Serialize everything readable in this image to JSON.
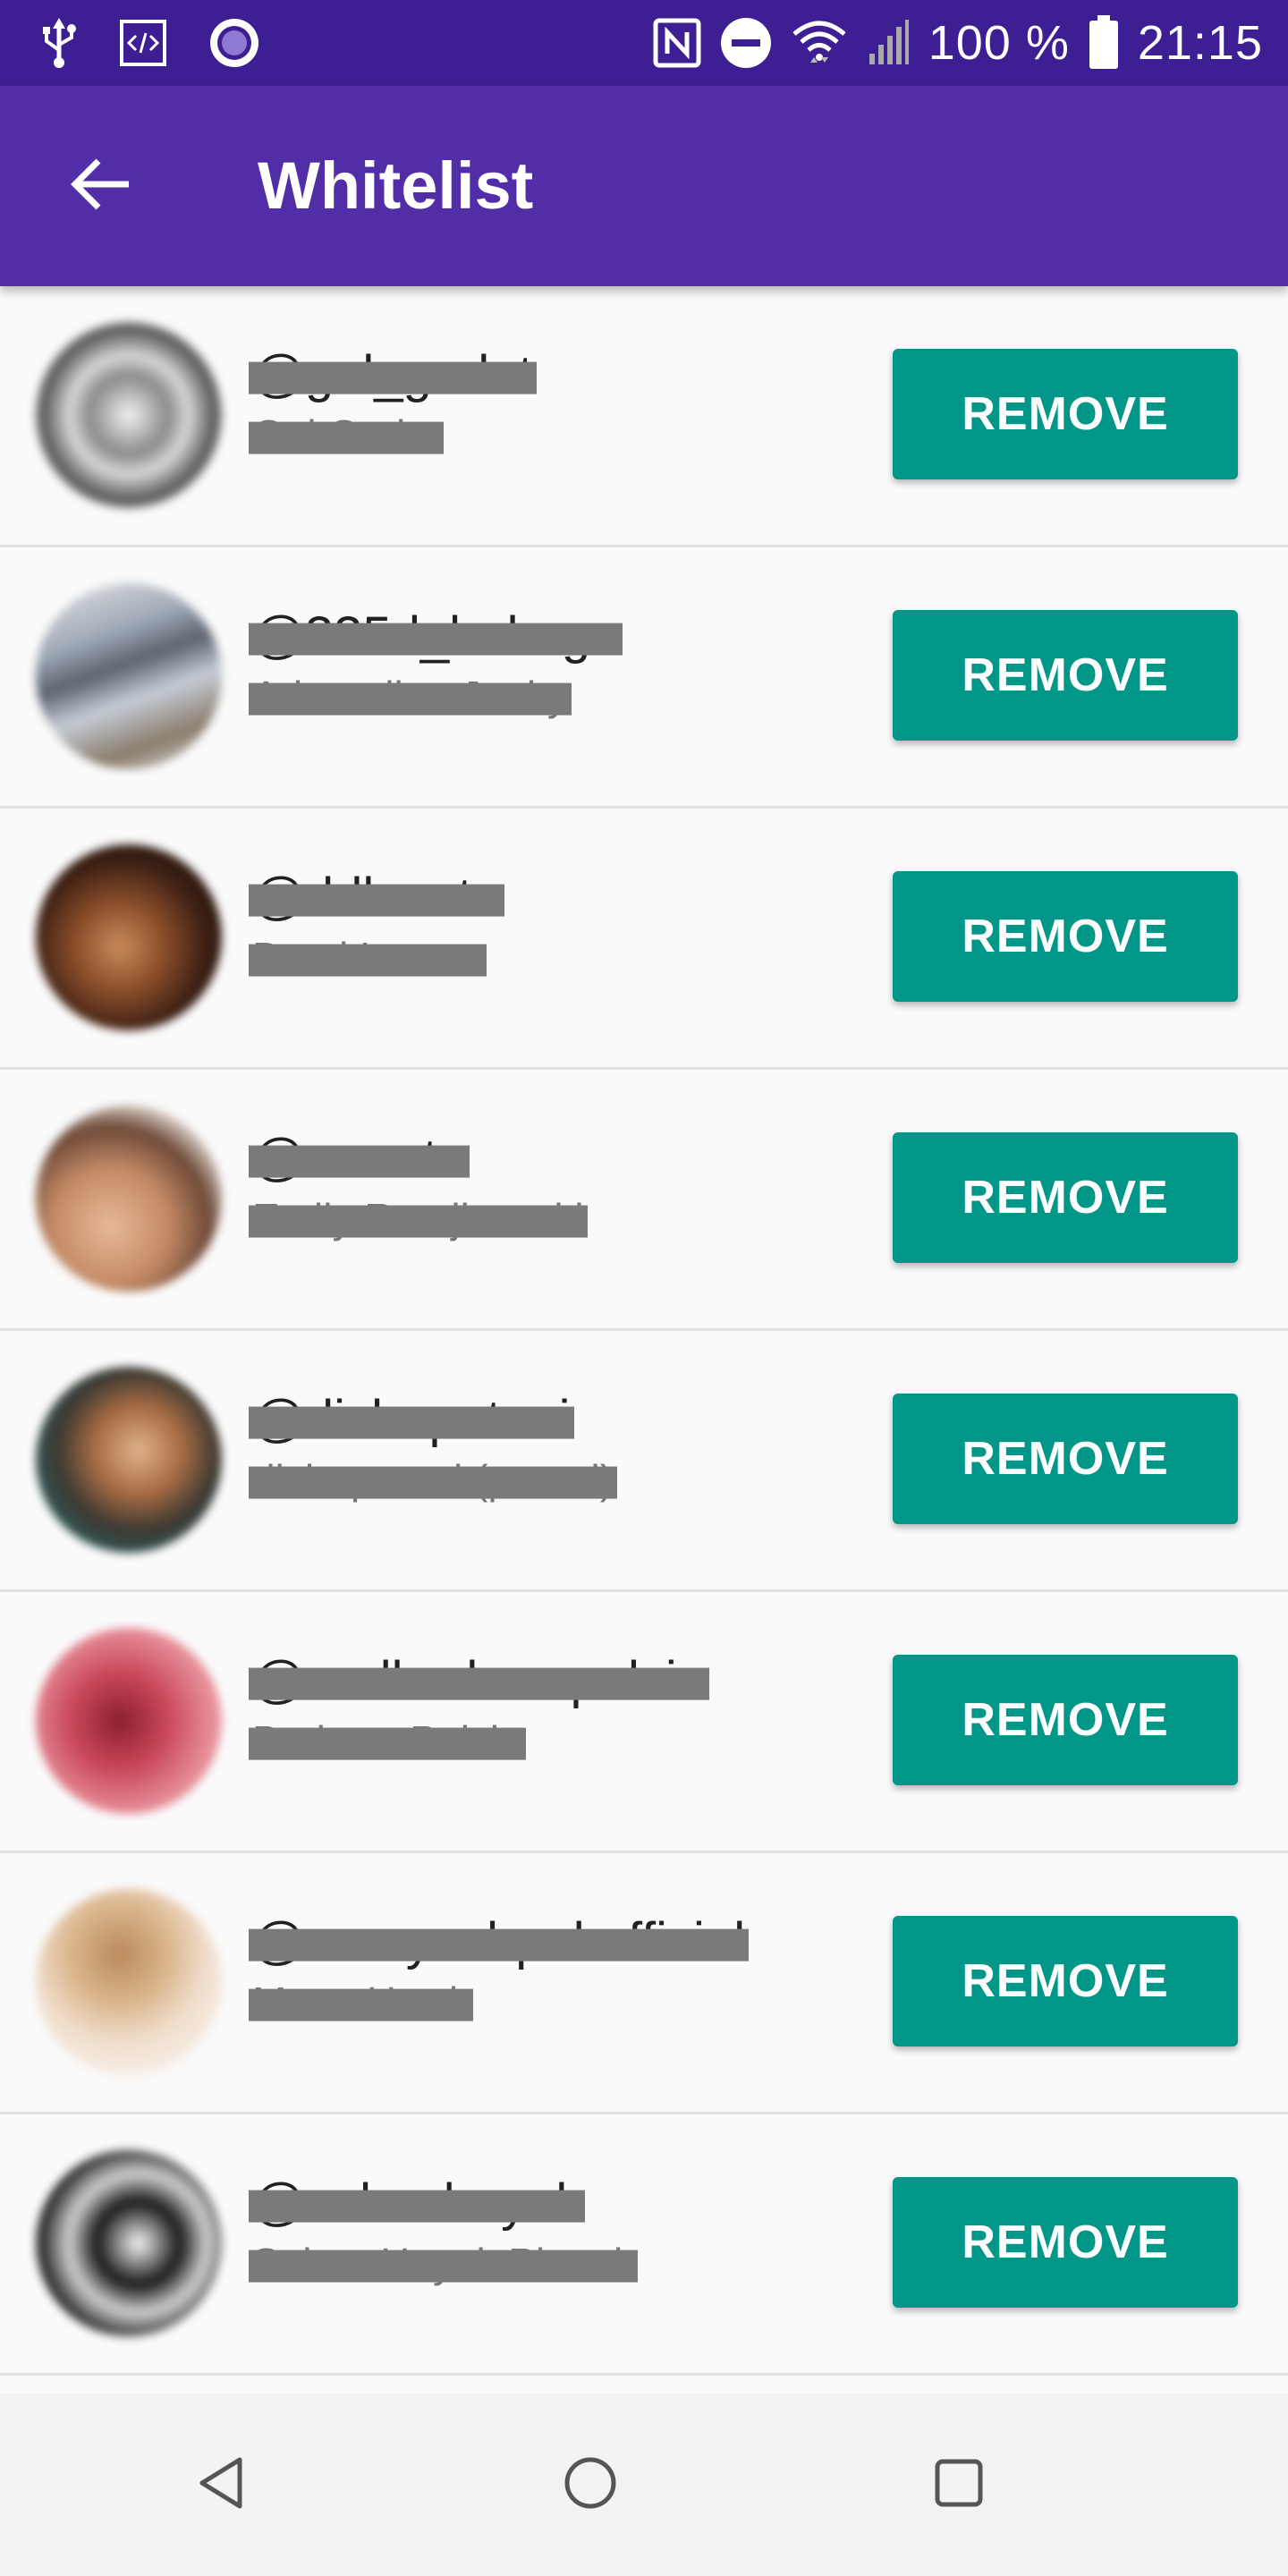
{
  "status_bar": {
    "battery_percent": "100 %",
    "time": "21:15",
    "icons": [
      "usb-icon",
      "code-icon",
      "record-icon",
      "nfc-icon",
      "dnd-icon",
      "wifi-icon",
      "signal-icon",
      "battery-icon"
    ]
  },
  "app_bar": {
    "title": "Whitelist",
    "back_icon": "arrow-back-icon"
  },
  "list": {
    "items": [
      {
        "username": "@gal_gadot",
        "full_name": "Gal Gadot",
        "button_label": "REMOVE"
      },
      {
        "username": "@335d_bokoge",
        "full_name": "Adrenaline Junky",
        "button_label": "REMOVE"
      },
      {
        "username": "@ddlovato",
        "full_name": "Demi Lovato",
        "button_label": "REMOVE"
      },
      {
        "username": "@emrata",
        "full_name": "Emily Ratajkowski",
        "button_label": "REMOVE"
      },
      {
        "username": "@dishapatani",
        "full_name": "dishapatani (paatni)",
        "button_label": "REMOVE"
      },
      {
        "username": "@realbarbarapalvin",
        "full_name": "Barbara Palvin",
        "button_label": "REMOVE"
      },
      {
        "username": "@maeyachpakofficial",
        "full_name": "Maea Hwak",
        "button_label": "REMOVE"
      },
      {
        "username": "@salmahayek",
        "full_name": "Salma Hayek Pinault",
        "button_label": "REMOVE"
      }
    ]
  },
  "nav_bar": {
    "icons": [
      "back-triangle-icon",
      "home-circle-icon",
      "recents-square-icon"
    ]
  },
  "colors": {
    "status_bar": "#3d1f93",
    "app_bar": "#512da8",
    "button": "#009688",
    "background": "#fafafa"
  }
}
